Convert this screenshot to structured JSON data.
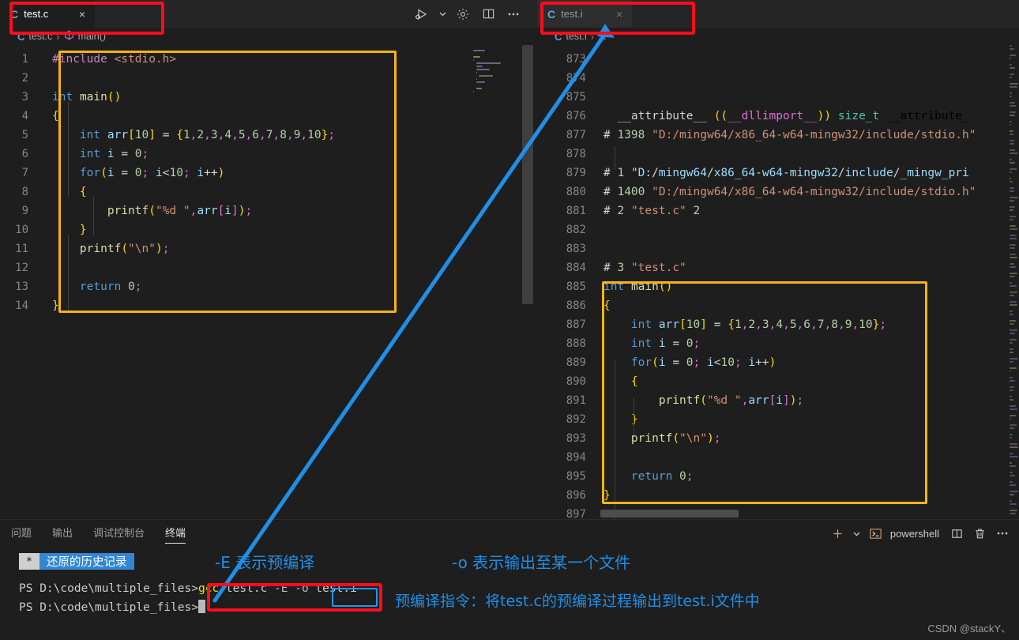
{
  "window": {
    "theme_bg": "#1e1e1e",
    "accent_highlight": "#f5b316",
    "accent_red": "#fc0d1b",
    "accent_blue": "#1f8fe8"
  },
  "editor_left": {
    "tab": {
      "icon": "C",
      "label": "test.c",
      "close": "×"
    },
    "breadcrumb": {
      "icon": "C",
      "file": "test.c",
      "separator": "›",
      "symbol": "main()"
    },
    "lines": [
      {
        "n": "1",
        "text": "#include <stdio.h>"
      },
      {
        "n": "2",
        "text": ""
      },
      {
        "n": "3",
        "text": "int main()"
      },
      {
        "n": "4",
        "text": "{"
      },
      {
        "n": "5",
        "text": "    int arr[10] = {1,2,3,4,5,6,7,8,9,10};"
      },
      {
        "n": "6",
        "text": "    int i = 0;"
      },
      {
        "n": "7",
        "text": "    for(i = 0; i<10; i++)"
      },
      {
        "n": "8",
        "text": "    {"
      },
      {
        "n": "9",
        "text": "        printf(\"%d \",arr[i]);"
      },
      {
        "n": "10",
        "text": "    }"
      },
      {
        "n": "11",
        "text": "    printf(\"\\n\");"
      },
      {
        "n": "12",
        "text": ""
      },
      {
        "n": "13",
        "text": "    return 0;"
      },
      {
        "n": "14",
        "text": "}"
      }
    ]
  },
  "editor_right": {
    "tab": {
      "icon": "C",
      "label": "test.i",
      "close": "×"
    },
    "breadcrumb": {
      "icon": "C",
      "file": "test.i",
      "separator": "›",
      "symbol": "..."
    },
    "lines": [
      {
        "n": "873",
        "text": ""
      },
      {
        "n": "874",
        "text": ""
      },
      {
        "n": "875",
        "text": ""
      },
      {
        "n": "876",
        "text": "  __attribute__ ((__dllimport__)) size_t __attribute_"
      },
      {
        "n": "877",
        "text": "# 1398 \"D:/mingw64/x86_64-w64-mingw32/include/stdio.h\""
      },
      {
        "n": "878",
        "text": ""
      },
      {
        "n": "879",
        "text": "# 1 \"D:/mingw64/x86_64-w64-mingw32/include/_mingw_pri"
      },
      {
        "n": "880",
        "text": "# 1400 \"D:/mingw64/x86_64-w64-mingw32/include/stdio.h\""
      },
      {
        "n": "881",
        "text": "# 2 \"test.c\" 2"
      },
      {
        "n": "882",
        "text": ""
      },
      {
        "n": "883",
        "text": ""
      },
      {
        "n": "884",
        "text": "# 3 \"test.c\""
      },
      {
        "n": "885",
        "text": "int main()"
      },
      {
        "n": "886",
        "text": "{"
      },
      {
        "n": "887",
        "text": "    int arr[10] = {1,2,3,4,5,6,7,8,9,10};"
      },
      {
        "n": "888",
        "text": "    int i = 0;"
      },
      {
        "n": "889",
        "text": "    for(i = 0; i<10; i++)"
      },
      {
        "n": "890",
        "text": "    {"
      },
      {
        "n": "891",
        "text": "        printf(\"%d \",arr[i]);"
      },
      {
        "n": "892",
        "text": "    }"
      },
      {
        "n": "893",
        "text": "    printf(\"\\n\");"
      },
      {
        "n": "894",
        "text": ""
      },
      {
        "n": "895",
        "text": "    return 0;"
      },
      {
        "n": "896",
        "text": "}"
      },
      {
        "n": "897",
        "text": ""
      }
    ]
  },
  "editor_toolbar": {
    "run_debug": "run-and-debug",
    "run_debug_chevron": "⌄",
    "settings": "settings-gear",
    "split": "split-editor-right",
    "more": "···"
  },
  "panel": {
    "tabs": [
      {
        "label": "问题",
        "selected": false
      },
      {
        "label": "输出",
        "selected": false
      },
      {
        "label": "调试控制台",
        "selected": false
      },
      {
        "label": "终端",
        "selected": true
      }
    ],
    "actions": {
      "new_terminal": "+",
      "new_terminal_chevron": "⌄",
      "shell_name": "powershell",
      "split_terminal": "split-terminal",
      "kill_terminal": "trash",
      "more": "···"
    },
    "history_badge": {
      "star": "*",
      "text": "还原的历史记录"
    },
    "terminal": {
      "prompt": "PS D:\\code\\multiple_files>",
      "command_program": "gcc",
      "command_args_1": " test.c ",
      "command_flag_e": "-E",
      "command_flag_o": " -o ",
      "command_output": "test.i",
      "second_prompt": "PS D:\\code\\multiple_files>"
    }
  },
  "annotations": [
    {
      "id": "anno-e-flag",
      "text": "-E 表示预编译"
    },
    {
      "id": "anno-o-flag",
      "text": "-o 表示输出至某一个文件"
    },
    {
      "id": "anno-command",
      "text": "预编译指令：将test.c的预编译过程输出到test.i文件中"
    }
  ],
  "watermark": "CSDN @stackY、"
}
